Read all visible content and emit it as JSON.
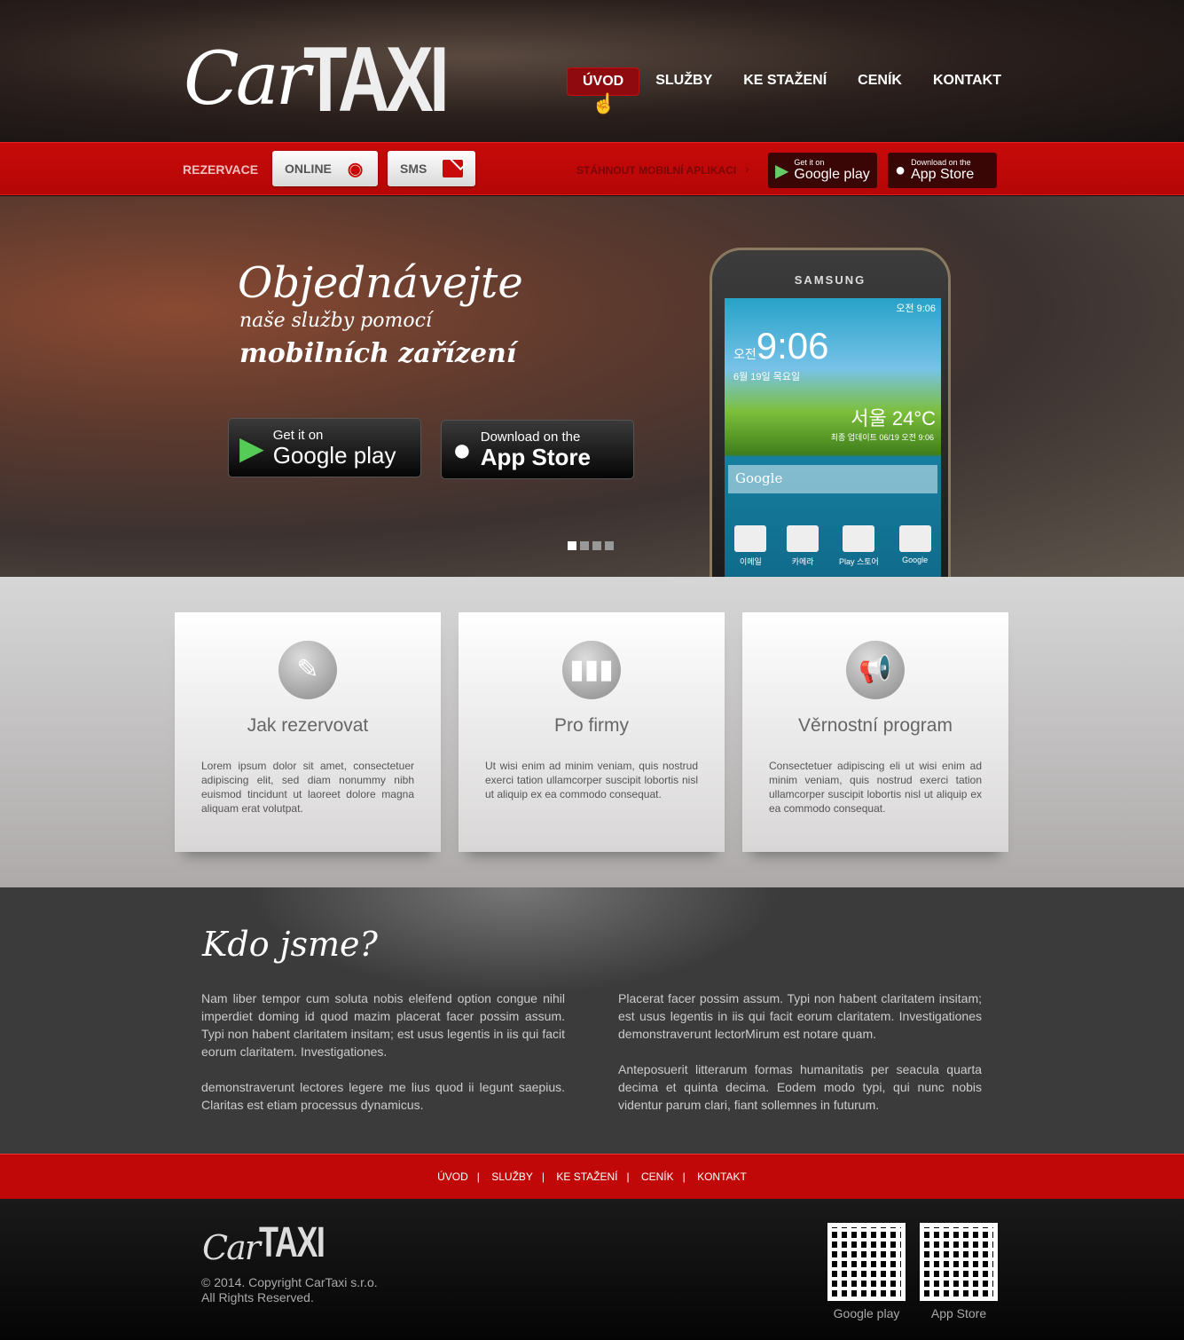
{
  "logo": {
    "car": "Car",
    "taxi": "TAXI"
  },
  "nav": [
    {
      "label": "ÚVOD",
      "active": true
    },
    {
      "label": "SLUŽBY"
    },
    {
      "label": "KE STAŽENÍ"
    },
    {
      "label": "CENÍK"
    },
    {
      "label": "KONTAKT"
    }
  ],
  "bar": {
    "rezervace": "REZERVACE",
    "online": "ONLINE",
    "sms": "SMS",
    "download": "STÁHNOUT MOBILNÍ APLIKACI",
    "google_small": "Get it on",
    "google_big": "Google play",
    "apple_small": "Download on the",
    "apple_big": "App Store"
  },
  "hero": {
    "line1": "Objednávejte",
    "line2": "naše služby pomocí",
    "line3": "mobilních zařízení",
    "google_small": "Get it on",
    "google_big": "Google play",
    "apple_small": "Download on the",
    "apple_big": "App Store",
    "slides": 4,
    "active_slide": 1,
    "phone": {
      "brand": "SAMSUNG",
      "status": "오전 9:06",
      "ampm": "오전",
      "time": "9:06",
      "date": "6월 19일 목요일",
      "weather": "서울 24°C",
      "update": "최종 업데이트 06/19 오전 9:06",
      "search": "Google",
      "apps": [
        "이메일",
        "카메라",
        "Play 스토어",
        "Google"
      ]
    }
  },
  "features": [
    {
      "title": "Jak rezervovat",
      "icon": "pencil-icon",
      "text": "Lorem ipsum dolor sit amet, consectetuer adipiscing elit, sed diam nonummy nibh euismod tincidunt ut laoreet dolore magna aliquam erat volutpat."
    },
    {
      "title": "Pro firmy",
      "icon": "business-icon",
      "text": "Ut wisi enim ad minim veniam, quis nostrud exerci tation ullamcorper suscipit lobortis nisl ut aliquip ex ea commodo consequat."
    },
    {
      "title": "Věrnostní program",
      "icon": "megaphone-icon",
      "text": "Consectetuer adipiscing eli ut wisi enim ad minim veniam, quis nostrud exerci tation ullamcorper suscipit lobortis nisl ut aliquip ex ea commodo consequat."
    }
  ],
  "about": {
    "title": "Kdo jsme?",
    "left": [
      "Nam liber tempor cum soluta nobis eleifend option congue nihil imperdiet doming id quod mazim placerat facer possim assum. Typi non habent claritatem insitam; est usus legentis in iis qui facit eorum claritatem. Investigationes.",
      "demonstraverunt lectores legere me lius quod ii legunt saepius. Claritas est etiam processus dynamicus."
    ],
    "right": [
      "Placerat facer possim assum. Typi non habent claritatem insitam; est usus legentis in iis qui facit eorum claritatem. Investigationes demonstraverunt lectorMirum est notare quam.",
      "Anteposuerit litterarum formas humanitatis per seacula quarta decima et quinta decima. Eodem modo typi, qui nunc nobis videntur parum clari, fiant sollemnes in futurum."
    ]
  },
  "footer_nav": [
    "ÚVOD",
    "SLUŽBY",
    "KE STAŽENÍ",
    "CENÍK",
    "KONTAKT"
  ],
  "footer": {
    "copyright": "© 2014. Copyright CarTaxi s.r.o.",
    "rights": "All Rights Reserved.",
    "qr_google": "Google play",
    "qr_apple": "App Store"
  }
}
